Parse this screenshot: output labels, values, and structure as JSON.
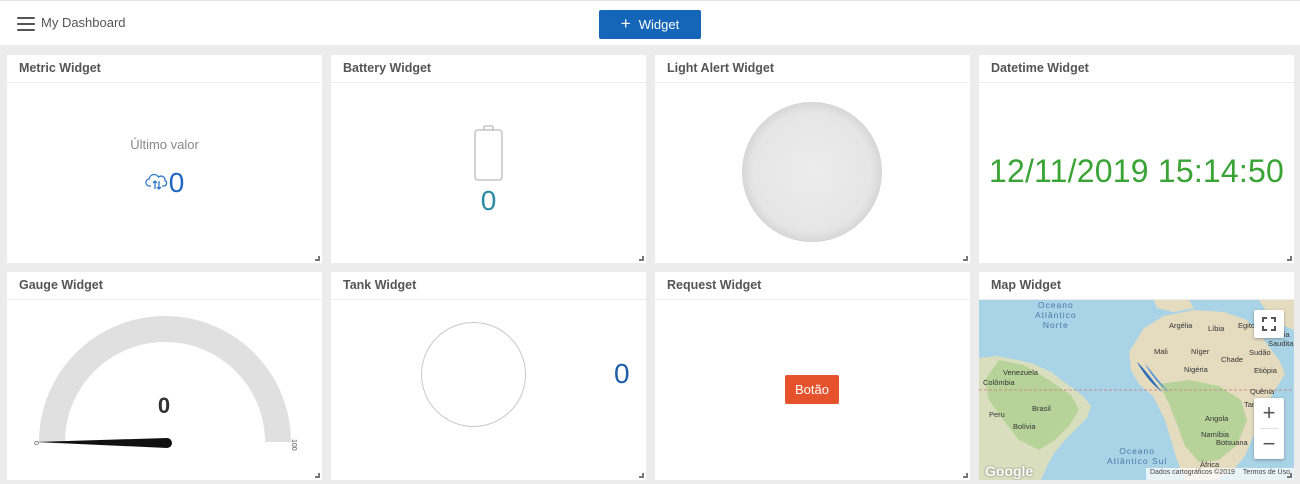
{
  "header": {
    "title": "My Dashboard",
    "add_widget_label": "Widget",
    "add_widget_color": "#1565b8"
  },
  "widgets": {
    "metric": {
      "title": "Metric Widget",
      "label": "Último valor",
      "value": "0",
      "icon": "cloud-sync-icon"
    },
    "battery": {
      "title": "Battery Widget",
      "value": "0",
      "icon": "battery-icon"
    },
    "light": {
      "title": "Light Alert Widget",
      "state": "off"
    },
    "datetime": {
      "title": "Datetime Widget",
      "value": "12/11/2019 15:14:50",
      "color": "#3aa335"
    },
    "gauge": {
      "title": "Gauge Widget",
      "value": "0",
      "min": "0",
      "max": "100"
    },
    "tank": {
      "title": "Tank Widget",
      "value": "0"
    },
    "request": {
      "title": "Request Widget",
      "button_label": "Botão",
      "button_color": "#e6522c"
    },
    "map": {
      "title": "Map Widget",
      "oceans": {
        "north": "Oceano\nAtlântico\nNorte",
        "south": "Oceano\nAtlântico Sul"
      },
      "labels": {
        "argelia": "Argélia",
        "libia": "Líbia",
        "egito": "Egito",
        "arabia": "Arábia\nSaudita",
        "mali": "Mali",
        "niger": "Níger",
        "chade": "Chade",
        "sudao": "Sudão",
        "nigeria": "Nigéria",
        "etiopia": "Etiópia",
        "quenia": "Quênia",
        "tanzania": "Tanzânia",
        "venezuela": "Venezuela",
        "colombia": "Colômbia",
        "peru": "Peru",
        "brasil": "Brasil",
        "bolivia": "Bolívia",
        "angola": "Angola",
        "namibia": "Namíbia",
        "botsuana": "Botsuana",
        "africa": "África"
      },
      "google": "Google",
      "attribution_data": "Dados cartográficos ©2019",
      "attribution_terms": "Termos de Uso"
    }
  }
}
